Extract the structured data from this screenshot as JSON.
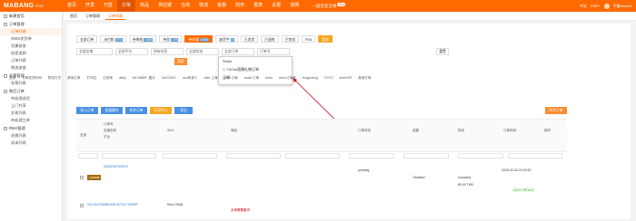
{
  "brand": {
    "logo": "MABANG",
    "sub": "ERP"
  },
  "nav": [
    "首页",
    "开发",
    "刊登",
    "订单",
    "商品",
    "供应链",
    "仓库",
    "物流",
    "客服",
    "财务",
    "报表",
    "设置",
    "官网",
    "一盘货卖全球"
  ],
  "nav_active": "订单",
  "nav_promo_badge": "NEW",
  "top_right": {
    "lang": "中文",
    "erp": "ERP+",
    "user": "不戴head01"
  },
  "sidebar": {
    "home": "新建首页",
    "group1": "订单管理",
    "items1": [
      "订单列表",
      "WMS发货单",
      "包裹核查",
      "档案追踪",
      "订单列表",
      "物流追查"
    ],
    "group2": "发票管理",
    "items2": [
      "发票列表"
    ],
    "group3": "售后订单",
    "items3": [
      "待处理退货",
      "上门共享",
      "交易列表",
      "待处理工单"
    ],
    "group4": "RMA管理",
    "items4": [
      "退换列表",
      "成本列表"
    ]
  },
  "tabs": [
    "首页",
    "订单管理",
    "订单列表"
  ],
  "status_tabs": [
    {
      "label": "全部订单"
    },
    {
      "label": "未付款",
      "count": "370"
    },
    {
      "label": "待审核",
      "count": "1106"
    },
    {
      "label": "待发",
      "count": "174"
    },
    {
      "label": "待处理",
      "count": "8760"
    },
    {
      "label": "缺货中",
      "count": "0"
    },
    {
      "label": "已发货"
    },
    {
      "label": "已退款"
    },
    {
      "label": "已完成"
    },
    {
      "label": "FBA"
    },
    {
      "label": "暂存"
    }
  ],
  "filters1": [
    "全部店铺",
    "全部平台",
    "所有标签",
    "全部状态",
    "全部订单",
    "订单号"
  ],
  "search_btn": "搜索",
  "reset_btn": "重置",
  "dropdown": {
    "items": [
      "Shlok",
      "TikTok直播礼物订单",
      "正常"
    ]
  },
  "chip_row": [
    "全部",
    "订单发货时间",
    "物流方式",
    "其他订单",
    "打印过",
    "已排序",
    "abby",
    "MLY888P--图片",
    "NOCNOC",
    "shu有多少",
    "ottle 上海",
    "ertal 订单",
    "ewall 订单",
    "temu",
    "temu订单号",
    "tongzheng",
    "TOTO",
    "sheinSR",
    "其他订单"
  ],
  "actions": {
    "import": "导入订单",
    "batch": "批量操作",
    "merge": "合并订单",
    "print": "打印中心",
    "export": "导出",
    "refresh": "同步订单"
  },
  "table_headers": [
    "全选",
    "订单号",
    "店铺名称",
    "平台",
    "SKU",
    "商品",
    "订单状态",
    "金额",
    "物流",
    "订单时间",
    "操作"
  ],
  "order1": {
    "id": "98342087920572",
    "store": "Lazada",
    "status": "pending",
    "country": "Thailand",
    "logistics": "economy",
    "amount": "80.00 THB",
    "time": "2025-02-26 22:03:20",
    "ship": "1天22小时16分"
  },
  "order2": {
    "id": "00276470598924567872077255DR",
    "sku": "Red 070ML",
    "note": "此单需要备货"
  },
  "colors": {
    "brand": "#ff6a00",
    "accent": "#ff8c2e",
    "blue": "#4a90e2"
  }
}
